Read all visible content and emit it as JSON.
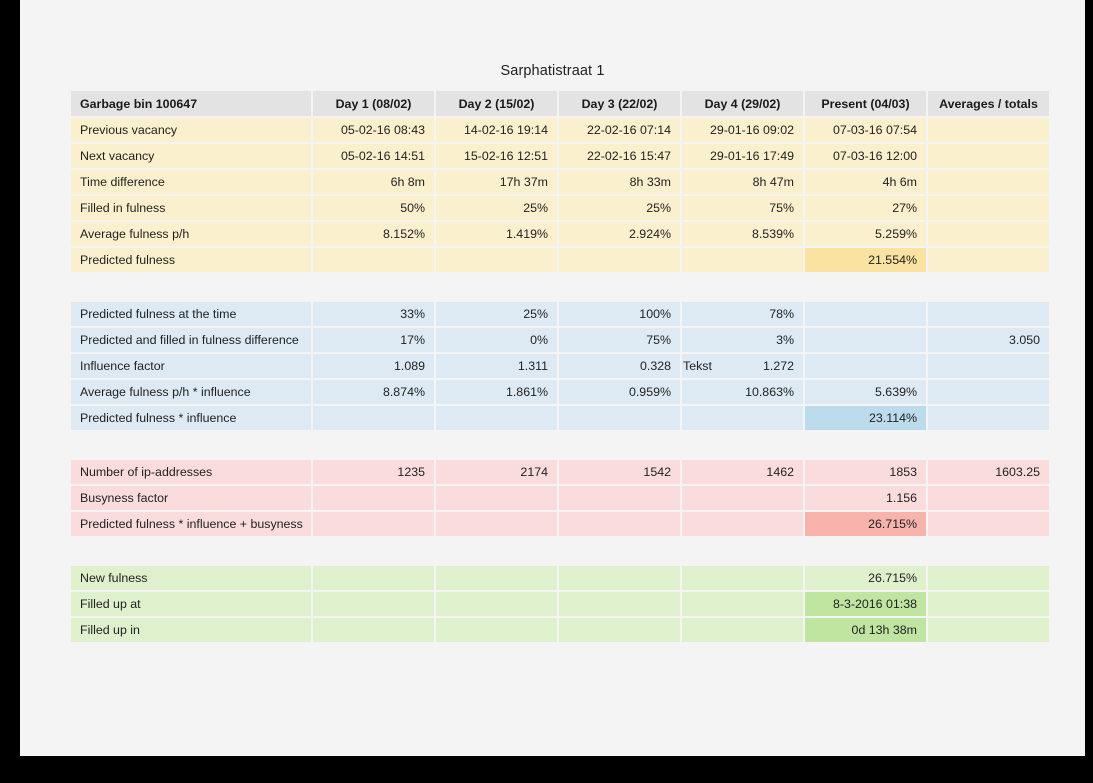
{
  "page": {
    "title": "Sarphatistraat 1",
    "background": "#f4f4f4",
    "frame_color": "#000000"
  },
  "columns": {
    "label_header": "Garbage bin 100647",
    "days": [
      "Day 1 (08/02)",
      "Day 2 (15/02)",
      "Day 3 (22/02)",
      "Day 4 (29/02)",
      "Present (04/03)"
    ],
    "averages_header": "Averages / totals"
  },
  "sections": [
    {
      "key": "measurements",
      "color": "#fbf0cd",
      "highlight_color": "#fae3a0",
      "rows": [
        {
          "label": "Previous vacancy",
          "cells": [
            "05-02-16 08:43",
            "14-02-16 19:14",
            "22-02-16 07:14",
            "29-01-16 09:02",
            "07-03-16 07:54",
            ""
          ]
        },
        {
          "label": "Next vacancy",
          "cells": [
            "05-02-16 14:51",
            "15-02-16 12:51",
            "22-02-16 15:47",
            "29-01-16 17:49",
            "07-03-16 12:00",
            ""
          ]
        },
        {
          "label": "Time difference",
          "cells": [
            "6h 8m",
            "17h 37m",
            "8h 33m",
            "8h 47m",
            "4h 6m",
            ""
          ]
        },
        {
          "label": "Filled in fulness",
          "cells": [
            "50%",
            "25%",
            "25%",
            "75%",
            "27%",
            ""
          ]
        },
        {
          "label": "Average fulness p/h",
          "cells": [
            "8.152%",
            "1.419%",
            "2.924%",
            "8.539%",
            "5.259%",
            ""
          ]
        },
        {
          "label": "Predicted fulness",
          "cells": [
            "",
            "",
            "",
            "",
            "21.554%",
            ""
          ],
          "highlight": [
            false,
            false,
            false,
            false,
            true,
            false
          ]
        }
      ]
    },
    {
      "key": "prediction",
      "color": "#ddeaf3",
      "highlight_color": "#bcdcee",
      "rows": [
        {
          "label": "Predicted fulness at the time",
          "cells": [
            "33%",
            "25%",
            "100%",
            "78%",
            "",
            ""
          ]
        },
        {
          "label": "Predicted and filled in fulness difference",
          "cells": [
            "17%",
            "0%",
            "75%",
            "3%",
            "",
            "3.050"
          ]
        },
        {
          "label": "Influence factor",
          "cells": [
            "1.089",
            "1.311",
            "0.328",
            "1.272",
            "",
            ""
          ],
          "overflow_cell": 2,
          "overflow_text": "Tekst"
        },
        {
          "label": "Average fulness p/h * influence",
          "cells": [
            "8.874%",
            "1.861%",
            "0.959%",
            "10.863%",
            "5.639%",
            ""
          ]
        },
        {
          "label": "Predicted fulness * influence",
          "cells": [
            "",
            "",
            "",
            "",
            "23.114%",
            ""
          ],
          "highlight": [
            false,
            false,
            false,
            false,
            true,
            false
          ]
        }
      ]
    },
    {
      "key": "busyness",
      "color": "#fbdcdc",
      "highlight_color": "#f8b3ad",
      "rows": [
        {
          "label": "Number of ip-addresses",
          "cells": [
            "1235",
            "2174",
            "1542",
            "1462",
            "1853",
            "1603.25"
          ]
        },
        {
          "label": "Busyness factor",
          "cells": [
            "",
            "",
            "",
            "",
            "1.156",
            ""
          ]
        },
        {
          "label": "Predicted fulness * influence + busyness",
          "cells": [
            "",
            "",
            "",
            "",
            "26.715%",
            ""
          ],
          "highlight": [
            false,
            false,
            false,
            false,
            true,
            false
          ]
        }
      ]
    },
    {
      "key": "result",
      "color": "#dff0cc",
      "highlight_color": "#bfe5a0",
      "rows": [
        {
          "label": "New fulness",
          "cells": [
            "",
            "",
            "",
            "",
            "26.715%",
            ""
          ]
        },
        {
          "label": "Filled up at",
          "cells": [
            "",
            "",
            "",
            "",
            "8-3-2016 01:38",
            ""
          ],
          "highlight": [
            false,
            false,
            false,
            false,
            true,
            false
          ]
        },
        {
          "label": "Filled up in",
          "cells": [
            "",
            "",
            "",
            "",
            "0d 13h 38m",
            ""
          ],
          "highlight": [
            false,
            false,
            false,
            false,
            true,
            false
          ]
        }
      ]
    }
  ]
}
